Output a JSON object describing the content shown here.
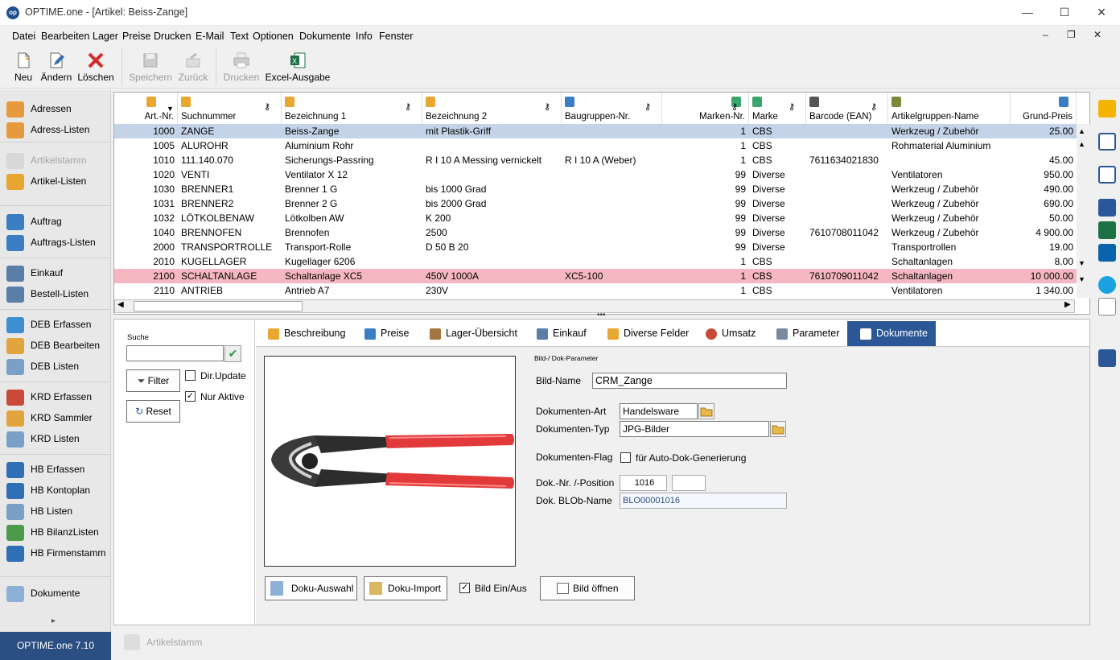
{
  "window": {
    "logo": "op",
    "title": "OPTIME.one - [Artikel: Beiss-Zange]",
    "minimize": "—",
    "maximize": "☐",
    "close": "✕"
  },
  "menu": [
    "Datei",
    "Bearbeiten",
    "Lager",
    "Preise",
    "Drucken",
    "E-Mail",
    "Text",
    "Optionen",
    "Dokumente",
    "Info",
    "Fenster"
  ],
  "mdi": {
    "minimize": "–",
    "restore": "❐",
    "close": "✕"
  },
  "toolbar": [
    {
      "label": "Neu",
      "icon": "new-document-icon",
      "enabled": true
    },
    {
      "label": "Ändern",
      "icon": "edit-icon",
      "enabled": true
    },
    {
      "label": "Löschen",
      "icon": "delete-x-icon",
      "enabled": true
    },
    {
      "label": "Speichern",
      "icon": "save-icon",
      "enabled": false
    },
    {
      "label": "Zurück",
      "icon": "undo-icon",
      "enabled": false
    },
    {
      "label": "Drucken",
      "icon": "printer-icon",
      "enabled": false
    },
    {
      "label": "Excel-Ausgabe",
      "icon": "excel-icon",
      "enabled": true
    }
  ],
  "sidebar": [
    {
      "label": "Adressen",
      "icon": "people-icon",
      "enabled": true
    },
    {
      "label": "Adress-Listen",
      "icon": "people-list-icon",
      "enabled": true
    },
    {
      "label": "Artikelstamm",
      "icon": "box-icon",
      "enabled": false
    },
    {
      "label": "Artikel-Listen",
      "icon": "box-list-icon",
      "enabled": true
    },
    {
      "label": "Auftrag",
      "icon": "order-icon",
      "enabled": true
    },
    {
      "label": "Auftrags-Listen",
      "icon": "order-list-icon",
      "enabled": true
    },
    {
      "label": "Einkauf",
      "icon": "cart-icon",
      "enabled": true
    },
    {
      "label": "Bestell-Listen",
      "icon": "cart-list-icon",
      "enabled": true
    },
    {
      "label": "DEB Erfassen",
      "icon": "debit-entry-icon",
      "enabled": true
    },
    {
      "label": "DEB Bearbeiten",
      "icon": "debit-edit-icon",
      "enabled": true
    },
    {
      "label": "DEB Listen",
      "icon": "debit-list-icon",
      "enabled": true
    },
    {
      "label": "KRD Erfassen",
      "icon": "credit-entry-icon",
      "enabled": true
    },
    {
      "label": "KRD Sammler",
      "icon": "credit-collect-icon",
      "enabled": true
    },
    {
      "label": "KRD Listen",
      "icon": "credit-list-icon",
      "enabled": true
    },
    {
      "label": "HB Erfassen",
      "icon": "ledger-entry-icon",
      "enabled": true
    },
    {
      "label": "HB Kontoplan",
      "icon": "ledger-plan-icon",
      "enabled": true
    },
    {
      "label": "HB Listen",
      "icon": "ledger-list-icon",
      "enabled": true
    },
    {
      "label": "HB BilanzListen",
      "icon": "balance-list-icon",
      "enabled": true
    },
    {
      "label": "HB Firmenstamm",
      "icon": "company-icon",
      "enabled": true
    },
    {
      "label": "Dokumente",
      "icon": "documents-icon",
      "enabled": true
    }
  ],
  "sidebar_expand": "▸",
  "status": {
    "app": "OPTIME.one  7.10",
    "taskbar_item": "Artikelstamm"
  },
  "grid": {
    "columns": [
      "Art.-Nr.",
      "Suchnummer",
      "Bezeichnung 1",
      "Bezeichnung 2",
      "Baugruppen-Nr.",
      "Marken-Nr.",
      "Marke",
      "Barcode (EAN)",
      "Artikelgruppen-Name",
      "Grund-Preis"
    ],
    "rows": [
      [
        "1000",
        "ZANGE",
        "Beiss-Zange",
        "mit Plastik-Griff",
        "",
        "1",
        "CBS",
        "",
        "Werkzeug / Zubehör",
        "25.00"
      ],
      [
        "1005",
        "ALUROHR",
        "Aluminium Rohr",
        "",
        "",
        "1",
        "CBS",
        "",
        "Rohmaterial Aluminium",
        ""
      ],
      [
        "1010",
        "111.140.070",
        "Sicherungs-Passring",
        "R I 10 A Messing vernickelt",
        "R I 10 A (Weber)",
        "1",
        "CBS",
        "7611634021830",
        "",
        "45.00"
      ],
      [
        "1020",
        "VENTI",
        "Ventilator X 12",
        "",
        "",
        "99",
        "Diverse",
        "",
        "Ventilatoren",
        "950.00"
      ],
      [
        "1030",
        "BRENNER1",
        "Brenner 1 G",
        "bis 1000 Grad",
        "",
        "99",
        "Diverse",
        "",
        "Werkzeug / Zubehör",
        "490.00"
      ],
      [
        "1031",
        "BRENNER2",
        "Brenner 2 G",
        "bis  2000 Grad",
        "",
        "99",
        "Diverse",
        "",
        "Werkzeug / Zubehör",
        "690.00"
      ],
      [
        "1032",
        "LÖTKOLBENAW",
        "Lötkolben AW",
        "K 200",
        "",
        "99",
        "Diverse",
        "",
        "Werkzeug / Zubehör",
        "50.00"
      ],
      [
        "1040",
        "BRENNOFEN",
        "Brennofen",
        "2500",
        "",
        "99",
        "Diverse",
        "7610708011042",
        "Werkzeug / Zubehör",
        "4 900.00"
      ],
      [
        "2000",
        "TRANSPORTROLLE",
        "Transport-Rolle",
        "D 50 B 20",
        "",
        "99",
        "Diverse",
        "",
        "Transportrollen",
        "19.00"
      ],
      [
        "2010",
        "KUGELLAGER",
        "Kugellager 6206",
        "",
        "",
        "1",
        "CBS",
        "",
        "Schaltanlagen",
        "8.00"
      ],
      [
        "2100",
        "SCHALTANLAGE",
        "Schaltanlage XC5",
        "450V 1000A",
        "XC5-100",
        "1",
        "CBS",
        "7610709011042",
        "Schaltanlagen",
        "10 000.00"
      ],
      [
        "2110",
        "ANTRIEB",
        "Antrieb A7",
        "230V",
        "",
        "1",
        "CBS",
        "",
        "Ventilatoren",
        "1 340.00"
      ]
    ],
    "selected_row": 0,
    "highlight_row": 10
  },
  "search": {
    "title": "Suche",
    "value": "",
    "filter": "Filter",
    "reset": "Reset",
    "dir_update": "Dir.Update",
    "dir_update_checked": false,
    "nur_aktive": "Nur Aktive",
    "nur_aktive_checked": true
  },
  "tabs": [
    "Beschreibung",
    "Preise",
    "Lager-Übersicht",
    "Einkauf",
    "Diverse Felder",
    "Umsatz",
    "Parameter",
    "Dokumente"
  ],
  "active_tab": "Dokumente",
  "doc": {
    "section": "Bild-/ Dok-Parameter",
    "bild_name_label": "Bild-Name",
    "bild_name": "CRM_Zange",
    "art_label": "Dokumenten-Art",
    "art": "Handelsware",
    "typ_label": "Dokumenten-Typ",
    "typ": "JPG-Bilder",
    "flag_label": "Dokumenten-Flag",
    "flag_text": "für Auto-Dok-Generierung",
    "flag_checked": false,
    "nr_label": "Dok.-Nr. /-Position",
    "nr": "1016",
    "position": "",
    "blob_label": "Dok. BLOb-Name",
    "blob": "BLO00001016",
    "btn_auswahl": "Doku-Auswahl",
    "btn_import": "Doku-Import",
    "bild_einaus": "Bild Ein/Aus",
    "bild_einaus_checked": true,
    "btn_oeffnen": "Bild öffnen"
  },
  "colors": {
    "selected_row": "#c5d3e8",
    "highlight_row": "#f5b8c0",
    "active_tab": "#2b5797",
    "statusbox": "#2b4f82"
  }
}
